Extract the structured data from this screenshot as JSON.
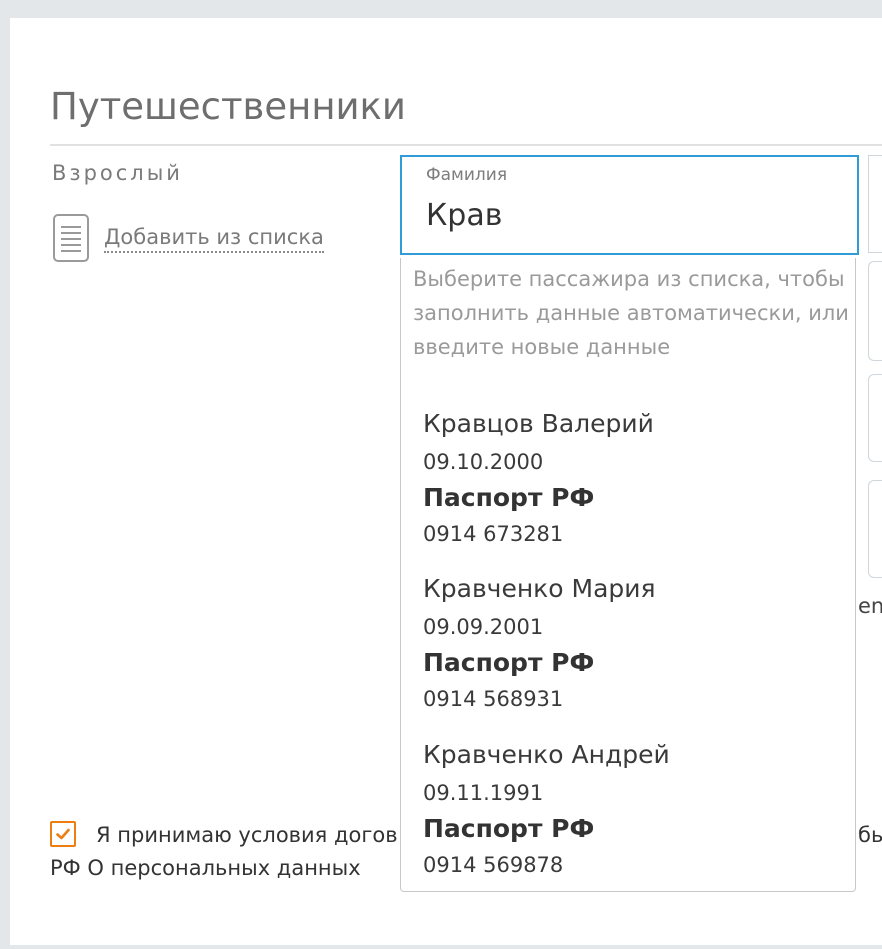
{
  "section": {
    "title": "Путешественники",
    "traveler_type": "Взрослый",
    "add_from_list": "Добавить из списка"
  },
  "surname": {
    "label": "Фамилия",
    "value": "Крав"
  },
  "suggestions": {
    "hint": "Выберите пассажира из списка, чтобы заполнить данные автоматически, или введите новые данные",
    "items": [
      {
        "name": "Кравцов Валерий",
        "birth_date": "09.10.2000",
        "document": "Паспорт РФ",
        "number": "0914 673281"
      },
      {
        "name": "Кравченко Мария",
        "birth_date": "09.09.2001",
        "document": "Паспорт РФ",
        "number": "0914 568931"
      },
      {
        "name": "Кравченко Андрей",
        "birth_date": "09.11.1991",
        "document": "Паспорт РФ",
        "number": "0914 569878"
      }
    ]
  },
  "right_edge_text": "en",
  "agreement": {
    "checked": true,
    "line1_start": "Я принимаю условия догов",
    "line1_end": "бы",
    "line2": "РФ О персональных данных"
  },
  "colors": {
    "focus_border": "#2f9bd7",
    "checkbox_accent": "#ee7d12",
    "background": "#e4e7ea"
  }
}
